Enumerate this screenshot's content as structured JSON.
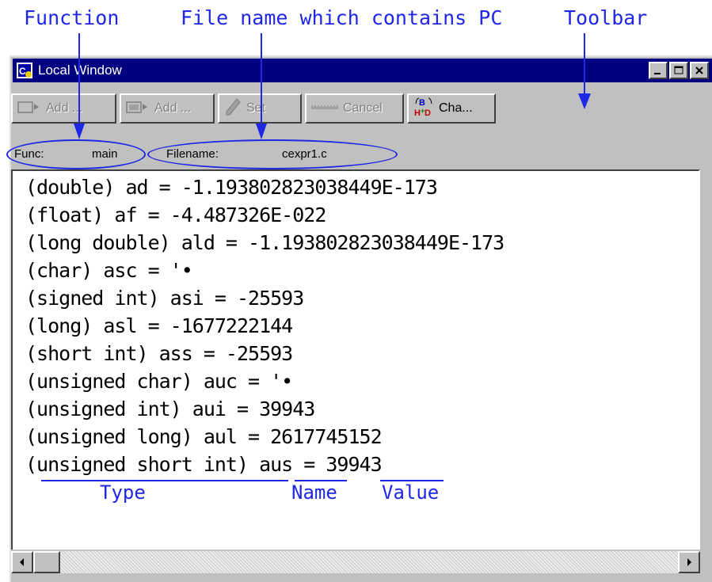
{
  "callouts": {
    "function": "Function",
    "filename": "File name which contains PC",
    "toolbar": "Toolbar"
  },
  "window": {
    "title": "Local Window",
    "minimize_icon": "minimize-icon",
    "maximize_icon": "maximize-icon",
    "close_icon": "close-icon"
  },
  "toolbar": {
    "buttons": [
      {
        "label": "Add ...",
        "icon": "add-watch-icon",
        "enabled": false
      },
      {
        "label": "Add ...",
        "icon": "add-watch-icon",
        "enabled": false
      },
      {
        "label": "Set",
        "icon": "pencil-icon",
        "enabled": false
      },
      {
        "label": "Cancel",
        "icon": "cancel-icon",
        "enabled": false
      },
      {
        "label": "Cha...",
        "icon": "change-radix-icon",
        "enabled": true
      }
    ]
  },
  "info": {
    "func_label": "Func:",
    "func_value": "main",
    "filename_label": "Filename:",
    "filename_value": "cexpr1.c"
  },
  "variables": [
    "(double) ad = -1.193802823038449E-173",
    "(float) af = -4.487326E-022",
    "(long double) ald = -1.193802823038449E-173",
    "(char) asc = '•",
    "(signed int) asi = -25593",
    "(long) asl = -1677222144",
    "(short int) ass = -25593",
    "(unsigned char) auc = '•",
    "(unsigned int) aui = 39943",
    "(unsigned long) aul = 2617745152",
    "(unsigned short int) aus = 39943"
  ],
  "legend": {
    "type": "Type",
    "name": "Name",
    "value": "Value"
  },
  "colors": {
    "annotation": "#1f27e6",
    "titlebar": "#000080",
    "face": "#c0c0c0"
  }
}
